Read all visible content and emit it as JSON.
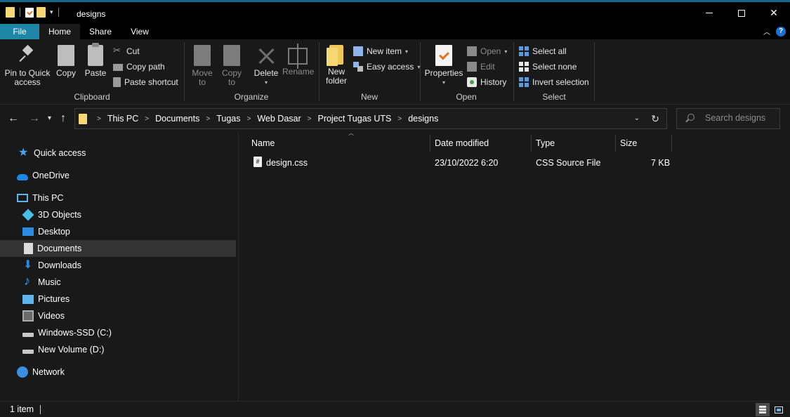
{
  "window": {
    "title": "designs",
    "controls": {
      "minimize": "",
      "maximize": "",
      "close": "✕"
    }
  },
  "ribbon_tabs": {
    "file": "File",
    "home": "Home",
    "share": "Share",
    "view": "View"
  },
  "ribbon": {
    "clipboard": {
      "label": "Clipboard",
      "pin_line1": "Pin to Quick",
      "pin_line2": "access",
      "copy": "Copy",
      "paste": "Paste",
      "cut": "Cut",
      "copy_path": "Copy path",
      "paste_shortcut": "Paste shortcut"
    },
    "organize": {
      "label": "Organize",
      "move_line1": "Move",
      "move_line2": "to",
      "copy_line1": "Copy",
      "copy_line2": "to",
      "delete": "Delete",
      "rename": "Rename"
    },
    "new": {
      "label": "New",
      "new_folder_line1": "New",
      "new_folder_line2": "folder",
      "new_item": "New item",
      "easy_access": "Easy access"
    },
    "open": {
      "label": "Open",
      "properties": "Properties",
      "open": "Open",
      "edit": "Edit",
      "history": "History"
    },
    "select": {
      "label": "Select",
      "select_all": "Select all",
      "select_none": "Select none",
      "invert_selection": "Invert selection"
    }
  },
  "address": {
    "crumbs": [
      "This PC",
      "Documents",
      "Tugas",
      "Web Dasar",
      "Project Tugas UTS",
      "designs"
    ]
  },
  "search": {
    "placeholder": "Search designs"
  },
  "nav": {
    "quick_access": "Quick access",
    "onedrive": "OneDrive",
    "this_pc": "This PC",
    "objects_3d": "3D Objects",
    "desktop": "Desktop",
    "documents": "Documents",
    "downloads": "Downloads",
    "music": "Music",
    "pictures": "Pictures",
    "videos": "Videos",
    "drive_c": "Windows-SSD (C:)",
    "drive_d": "New Volume (D:)",
    "network": "Network"
  },
  "columns": {
    "name": "Name",
    "date": "Date modified",
    "type": "Type",
    "size": "Size"
  },
  "files": [
    {
      "name": "design.css",
      "date": "23/10/2022 6:20",
      "type": "CSS Source File",
      "size": "7 KB",
      "icon": "#"
    }
  ],
  "status": {
    "count": "1 item"
  },
  "colors": {
    "accent": "#1e87a8",
    "background": "#191919",
    "selected": "#333333",
    "folder": "#f7d774"
  }
}
